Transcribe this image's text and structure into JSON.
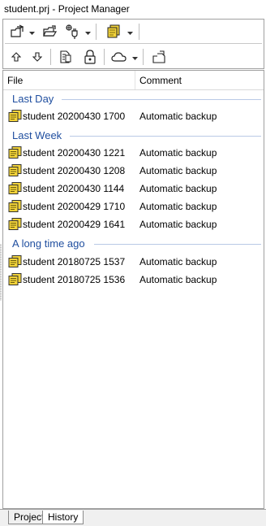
{
  "window": {
    "title": "student.prj - Project Manager"
  },
  "toolbar": {
    "row1": [
      {
        "icon": "open-project-icon",
        "has_dropdown": true
      },
      {
        "icon": "open-folder-icon",
        "has_dropdown": false
      },
      {
        "icon": "connect-plug-icon",
        "has_dropdown": true
      },
      {
        "icon": "backup-icon",
        "has_dropdown": true
      }
    ],
    "row2": [
      {
        "icon": "move-up-icon"
      },
      {
        "icon": "move-down-icon"
      },
      {
        "icon": "document-info-icon"
      },
      {
        "icon": "lock-icon"
      },
      {
        "icon": "cloud-icon",
        "has_dropdown": true
      },
      {
        "icon": "export-icon"
      }
    ]
  },
  "columns": {
    "file": "File",
    "comment": "Comment"
  },
  "groups": [
    {
      "label": "Last Day",
      "rows": [
        {
          "file": "student 20200430 1700",
          "comment": "Automatic backup"
        }
      ]
    },
    {
      "label": "Last Week",
      "rows": [
        {
          "file": "student 20200430 1221",
          "comment": "Automatic backup"
        },
        {
          "file": "student 20200430 1208",
          "comment": "Automatic backup"
        },
        {
          "file": "student 20200430 1144",
          "comment": "Automatic backup"
        },
        {
          "file": "student 20200429 1710",
          "comment": "Automatic backup"
        },
        {
          "file": "student 20200429 1641",
          "comment": "Automatic backup"
        }
      ]
    },
    {
      "label": "A long time ago",
      "rows": [
        {
          "file": "student 20180725 1537",
          "comment": "Automatic backup"
        },
        {
          "file": "student 20180725 1536",
          "comment": "Automatic backup"
        }
      ]
    }
  ],
  "tabs": [
    {
      "label": "Project",
      "active": false
    },
    {
      "label": "History",
      "active": true
    }
  ],
  "colors": {
    "group_label": "#1f4e9f",
    "group_line": "#b9c9e6",
    "icon_yellow": "#f2d33a"
  }
}
